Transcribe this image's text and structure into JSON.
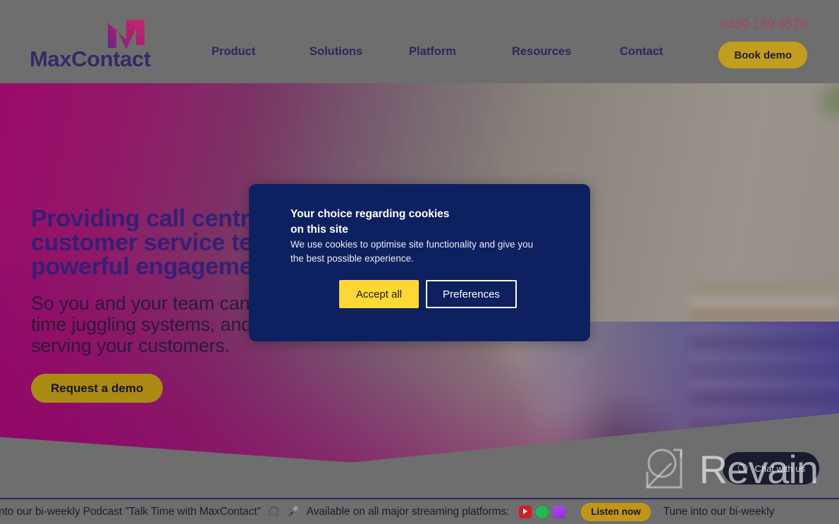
{
  "header": {
    "logo_word": "MaxContact",
    "logo_icon": "maxcontact-m-logo",
    "nav": [
      {
        "label": "Product"
      },
      {
        "label": "Solutions"
      },
      {
        "label": "Platform"
      },
      {
        "label": "Resources"
      },
      {
        "label": "Contact"
      }
    ],
    "phone": "0330 159 6570",
    "book_demo_label": "Book demo"
  },
  "hero": {
    "headline_lines": [
      "Providing call centres and",
      "customer service teams with",
      "powerful engagement tools"
    ],
    "subhead_lines": [
      "So you and your team can spend less",
      "time juggling systems, and more time",
      "serving your customers."
    ],
    "cta_label": "Request a demo"
  },
  "cookie_dialog": {
    "title_lines": [
      "Your choice regarding cookies",
      "on this site"
    ],
    "body_lines": [
      "We use cookies to optimise site functionality and give you",
      "the best possible experience."
    ],
    "accept_label": "Accept all",
    "preferences_label": "Preferences"
  },
  "chat_widget": {
    "label": "Chat with us",
    "icon": "chat-bubble-icon"
  },
  "watermark": {
    "text": "Revain",
    "icon": "revain-q-logo"
  },
  "banner": {
    "lead_text": "e into our bi-weekly Podcast \"Talk Time with MaxContact\"",
    "emoji_headphones": "🎧",
    "emoji_microphone": "🎤",
    "availability_text": "Available on all major streaming platforms:",
    "platforms": [
      {
        "name": "youtube-icon"
      },
      {
        "name": "spotify-icon"
      },
      {
        "name": "apple-podcasts-icon"
      }
    ],
    "listen_label": "Listen now",
    "trailing_text": "Tune into our bi-weekly"
  },
  "colors": {
    "brand_navy": "#2e1f78",
    "brand_magenta": "#b03a6a",
    "accent_gold": "#c9a21a",
    "dialog_bg": "#0d2160",
    "accept_yellow": "#fdd835"
  }
}
